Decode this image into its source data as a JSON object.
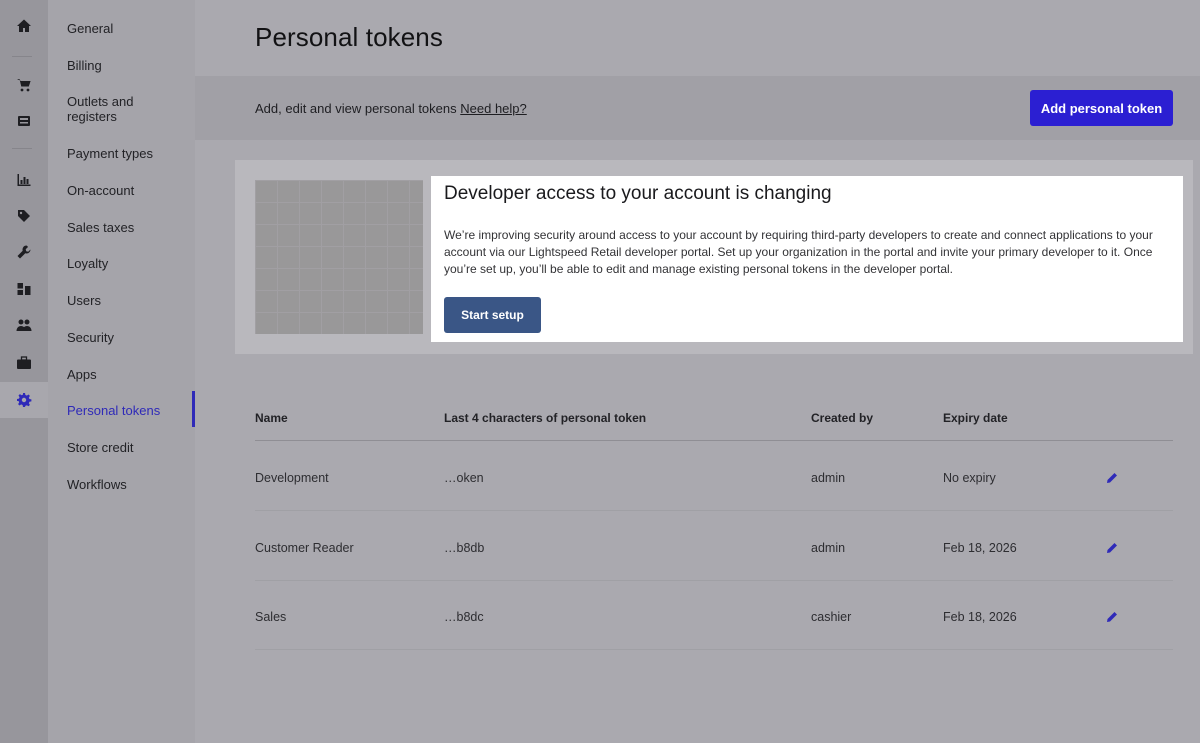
{
  "rail": {
    "icons": [
      "home-icon",
      "cart-icon",
      "register-icon",
      "reports-icon",
      "tag-icon",
      "wrench-icon",
      "inventory-icon",
      "customers-icon",
      "briefcase-icon",
      "gear-icon"
    ],
    "active": "gear-icon",
    "active_color": "#2f2ab8"
  },
  "settings_nav": {
    "items": [
      {
        "label": "General"
      },
      {
        "label": "Billing"
      },
      {
        "label": "Outlets and registers"
      },
      {
        "label": "Payment types"
      },
      {
        "label": "On-account"
      },
      {
        "label": "Sales taxes"
      },
      {
        "label": "Loyalty"
      },
      {
        "label": "Users"
      },
      {
        "label": "Security"
      },
      {
        "label": "Apps"
      },
      {
        "label": "Personal tokens"
      },
      {
        "label": "Store credit"
      },
      {
        "label": "Workflows"
      }
    ],
    "active": "Personal tokens"
  },
  "page": {
    "title": "Personal tokens"
  },
  "toolbar": {
    "description": "Add, edit and view personal tokens",
    "help_link": "Need help?",
    "add_button": "Add personal token",
    "button_color": "#2b1fd2"
  },
  "banner": {
    "title": "Developer access to your account is changing",
    "body": "We’re improving security around access to your account by requiring third-party developers to create and connect applications to your account via our Lightspeed Retail developer portal. Set up your organization in the portal and invite your primary developer to it. Once you’re set up, you’ll be able to edit and manage existing personal tokens in the developer portal.",
    "button": "Start setup",
    "button_color": "#3a5686"
  },
  "table": {
    "columns": [
      "Name",
      "Last 4 characters of personal token",
      "Created by",
      "Expiry date"
    ],
    "rows": [
      {
        "name": "Development",
        "last4": "…oken",
        "created_by": "admin",
        "expiry": "No expiry"
      },
      {
        "name": "Customer Reader",
        "last4": "…b8db",
        "created_by": "admin",
        "expiry": "Feb 18, 2026"
      },
      {
        "name": "Sales",
        "last4": "…b8dc",
        "created_by": "cashier",
        "expiry": "Feb 18, 2026"
      }
    ]
  }
}
